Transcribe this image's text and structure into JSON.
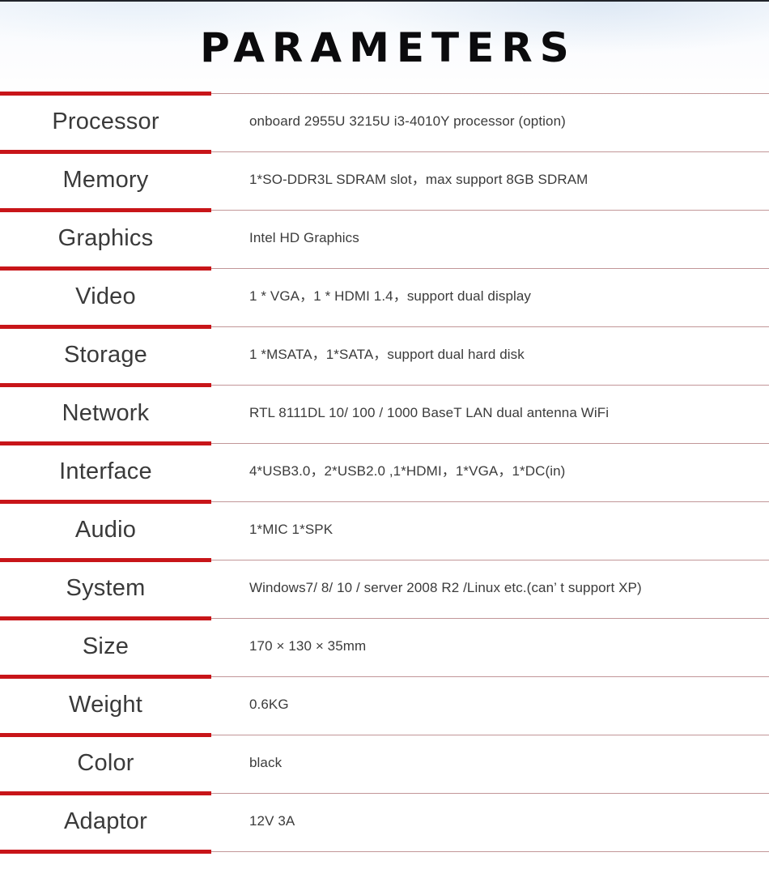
{
  "page": {
    "title": "PARAMETERS",
    "accent_color": "#c81519",
    "rule_color": "#c29698",
    "label_color": "#3a3a3a",
    "value_color": "#3b3b3b",
    "background_color": "#ffffff"
  },
  "spec_table": {
    "rows": [
      {
        "label": "Processor",
        "value": "onboard 2955U  3215U  i3-4010Y processor (option)"
      },
      {
        "label": "Memory",
        "value": "1*SO-DDR3L SDRAM slot，max support 8GB SDRAM"
      },
      {
        "label": "Graphics",
        "value": "Intel HD Graphics"
      },
      {
        "label": "Video",
        "value": "1 * VGA，1 * HDMI 1.4，support dual display"
      },
      {
        "label": "Storage",
        "value": "1 *MSATA，1*SATA，support dual hard disk"
      },
      {
        "label": "Network",
        "value": "RTL 8111DL 10/ 100 / 1000 BaseT LAN dual antenna WiFi"
      },
      {
        "label": "Interface",
        "value": "4*USB3.0，2*USB2.0 ,1*HDMI，1*VGA，1*DC(in)"
      },
      {
        "label": "Audio",
        "value": "1*MIC  1*SPK"
      },
      {
        "label": "System",
        "value": "Windows7/ 8/ 10 / server 2008 R2 /Linux etc.(can’ t support XP)"
      },
      {
        "label": "Size",
        "value": "170 × 130 × 35mm"
      },
      {
        "label": "Weight",
        "value": "0.6KG"
      },
      {
        "label": "Color",
        "value": "black"
      },
      {
        "label": "Adaptor",
        "value": "12V 3A"
      }
    ]
  }
}
